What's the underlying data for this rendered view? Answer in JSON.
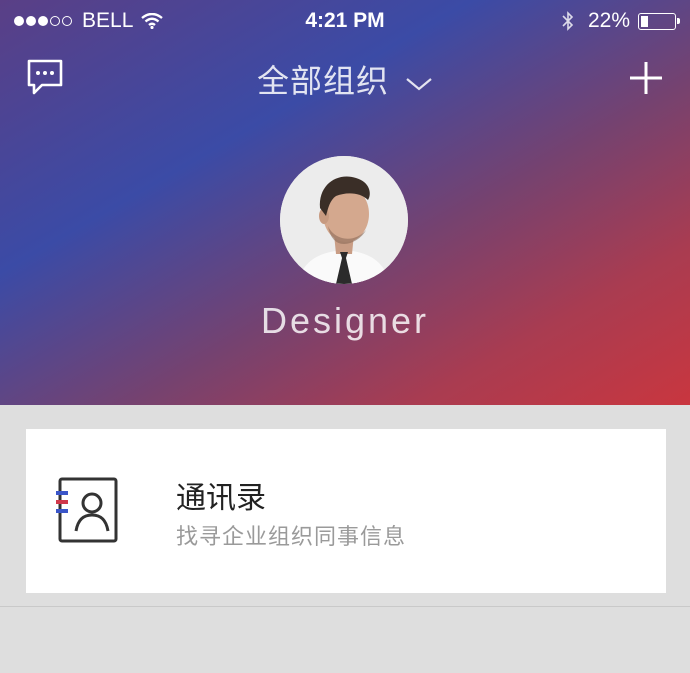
{
  "status_bar": {
    "carrier": "BELL",
    "time": "4:21 PM",
    "battery_percent": "22%",
    "battery_level": 0.22,
    "signal_bars_filled": 3,
    "signal_bars_total": 5
  },
  "nav": {
    "title": "全部组织",
    "left_icon": "chat-bubble-icon",
    "right_icon": "plus-icon",
    "dropdown_icon": "chevron-down-icon"
  },
  "profile": {
    "name": "Designer"
  },
  "cards": [
    {
      "title": "通讯录",
      "subtitle": "找寻企业组织同事信息",
      "icon": "contacts-book-icon"
    }
  ],
  "colors": {
    "gradient_blue": "#3b4ba6",
    "gradient_red": "#c9363f",
    "background": "#dedede",
    "card": "#ffffff",
    "accent_blue": "#3a55c8",
    "accent_red": "#d0384a"
  }
}
